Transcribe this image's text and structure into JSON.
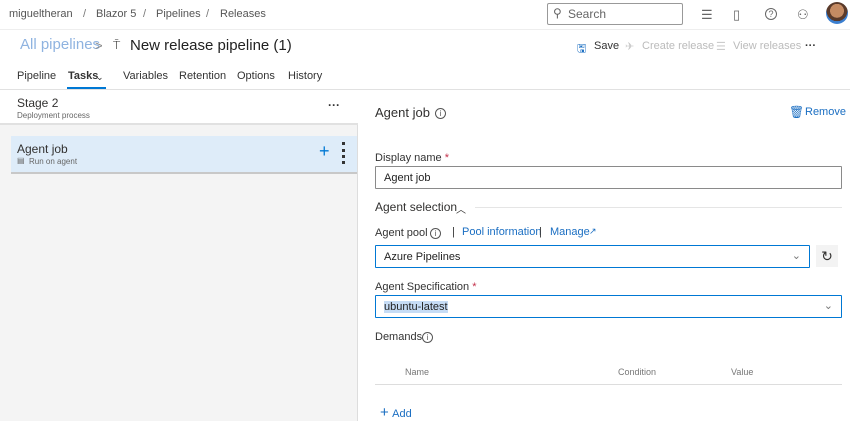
{
  "breadcrumb": [
    "migueltheran",
    "Blazor 5",
    "Pipelines",
    "Releases"
  ],
  "breadcrumb_sep": "/",
  "search": {
    "placeholder": "Search"
  },
  "header": {
    "all_pipelines": "All pipelines",
    "chevron": ">",
    "title": "New release pipeline (1)"
  },
  "actions": {
    "save": "Save",
    "create_release": "Create release",
    "view_releases": "View releases",
    "more": "···"
  },
  "tabs": [
    "Pipeline",
    "Tasks",
    "Variables",
    "Retention",
    "Options",
    "History"
  ],
  "stage": {
    "name": "Stage 2",
    "subtitle": "Deployment process",
    "more": "···"
  },
  "job": {
    "name": "Agent job",
    "subtitle": "Run on agent"
  },
  "panel": {
    "title": "Agent job",
    "remove": "Remove",
    "display_name_label": "Display name",
    "required": "*",
    "display_name_value": "Agent job",
    "agent_selection": "Agent selection",
    "agent_pool_label": "Agent pool",
    "pool_info": "Pool information",
    "manage": "Manage",
    "pipe": "|",
    "agent_pool_value": "Azure Pipelines",
    "agent_spec_label": "Agent Specification",
    "agent_spec_value": "ubuntu-latest",
    "demands_label": "Demands",
    "columns": [
      "Name",
      "Condition",
      "Value"
    ],
    "add": "Add"
  }
}
